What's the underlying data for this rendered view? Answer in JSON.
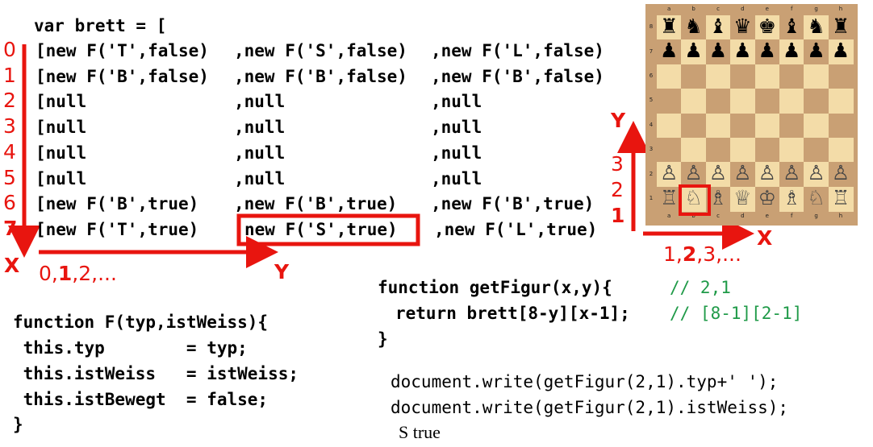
{
  "brett_code": {
    "header": "var brett = [",
    "row_indices": [
      "0",
      "1",
      "2",
      "3",
      "4",
      "5",
      "6",
      "7"
    ],
    "rows": [
      [
        "[new F('T',false)",
        ",new F('S',false)",
        ",new F('L',false)"
      ],
      [
        "[new F('B',false)",
        ",new F('B',false)",
        ",new F('B',false)"
      ],
      [
        "[null",
        ",null",
        ",null"
      ],
      [
        "[null",
        ",null",
        ",null"
      ],
      [
        "[null",
        ",null",
        ",null"
      ],
      [
        "[null",
        ",null",
        ",null"
      ],
      [
        "[new F('B',true)",
        ",new F('B',true)",
        ",new F('B',true)"
      ],
      [
        "[new F('T',true)",
        "new F('S',true)",
        ",new F('L',true)"
      ]
    ],
    "axis_x_label": "X",
    "axis_y_label": "Y",
    "column_index_prefix": "0,",
    "column_index_bold": "1",
    "column_index_suffix": ",2,..."
  },
  "class_code": {
    "line1": "function F(typ,istWeiss){",
    "line2": " this.typ        = typ;",
    "line3": " this.istWeiss   = istWeiss;",
    "line4": " this.istBewegt  = false;",
    "line5": "}"
  },
  "getfigur_code": {
    "line1": "function getFigur(x,y){",
    "comment1": "// 2,1",
    "line2": "return brett[8-y][x-1];",
    "comment2": "// [8-1][2-1]",
    "line3": "}",
    "write1": "document.write(getFigur(2,1).typ+' ');",
    "write2": "document.write(getFigur(2,1).istWeiss);",
    "output": "S true"
  },
  "chessboard": {
    "files": [
      "a",
      "b",
      "c",
      "d",
      "e",
      "f",
      "g",
      "h"
    ],
    "ranks": [
      "8",
      "7",
      "6",
      "5",
      "4",
      "3",
      "2",
      "1"
    ],
    "rank8": [
      "♜",
      "♞",
      "♝",
      "♛",
      "♚",
      "♝",
      "♞",
      "♜"
    ],
    "rank7": [
      "♟",
      "♟",
      "♟",
      "♟",
      "♟",
      "♟",
      "♟",
      "♟"
    ],
    "rank2": [
      "♙",
      "♙",
      "♙",
      "♙",
      "♙",
      "♙",
      "♙",
      "♙"
    ],
    "rank1": [
      "♖",
      "♘",
      "♗",
      "♕",
      "♔",
      "♗",
      "♘",
      "♖"
    ],
    "light_color": "#f3dca8",
    "dark_color": "#c9a074",
    "highlight": "b1"
  },
  "board_axes": {
    "y_label": "Y",
    "x_label": "X",
    "rank_numbers": [
      "3",
      "2",
      "1"
    ],
    "file_numbers_prefix": "1,",
    "file_numbers_bold": "2",
    "file_numbers_suffix": ",3,..."
  },
  "colors": {
    "accent_red": "#e8150f",
    "comment_green": "#1f9a48"
  }
}
